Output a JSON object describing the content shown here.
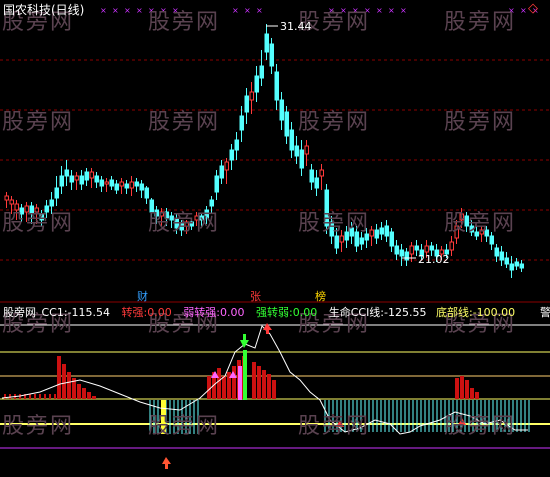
{
  "title": "国农科技(日线)",
  "watermark": "股旁网",
  "price_high_label": "31.44",
  "price_low_label": "21.02",
  "top_corner_icon": "diamond-icon",
  "markers": {
    "cai": "财",
    "zhang": "张",
    "bang": "榜"
  },
  "indicator": {
    "name": "股旁网",
    "cci_label": "CC1:",
    "cci_value": "-115.54",
    "zhuanqiang_label": "转强:",
    "zhuanqiang_value": "0.00",
    "ruozhuanqiang_label": "弱转强:",
    "ruozhuanqiang_value": "0.00",
    "qiangzhuanruo_label": "强转弱:",
    "qiangzhuanruo_value": "0.00",
    "life_cci_label": "生命CCI线:",
    "life_cci_value": "-125.55",
    "bottom_line_label": "底部线:",
    "bottom_line_value": "-100.00",
    "truncated": "警"
  },
  "colors": {
    "up": "#ff3a3a",
    "down": "#54ffff",
    "grid": "#8b0000",
    "watermark": "#5a4250"
  }
}
